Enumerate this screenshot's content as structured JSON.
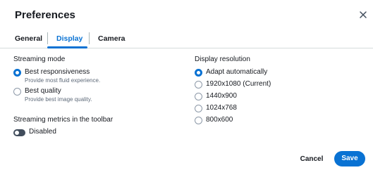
{
  "dialog": {
    "title": "Preferences",
    "close_icon": "close-icon"
  },
  "tabs": [
    {
      "label": "General",
      "active": false
    },
    {
      "label": "Display",
      "active": true
    },
    {
      "label": "Camera",
      "active": false
    }
  ],
  "streaming_mode": {
    "label": "Streaming mode",
    "options": [
      {
        "label": "Best responsiveness",
        "description": "Provide most fluid experience.",
        "selected": true
      },
      {
        "label": "Best quality",
        "description": "Provide best image quality.",
        "selected": false
      }
    ]
  },
  "metrics": {
    "label": "Streaming metrics in the toolbar",
    "toggle_label": "Disabled",
    "enabled": false
  },
  "resolution": {
    "label": "Display resolution",
    "options": [
      {
        "label": "Adapt automatically",
        "selected": true
      },
      {
        "label": "1920x1080 (Current)",
        "selected": false
      },
      {
        "label": "1440x900",
        "selected": false
      },
      {
        "label": "1024x768",
        "selected": false
      },
      {
        "label": "800x600",
        "selected": false
      }
    ]
  },
  "footer": {
    "cancel_label": "Cancel",
    "save_label": "Save"
  },
  "colors": {
    "accent": "#0972d3",
    "text": "#16191f",
    "muted": "#5f6b7a",
    "toggle_off": "#414d5c"
  }
}
